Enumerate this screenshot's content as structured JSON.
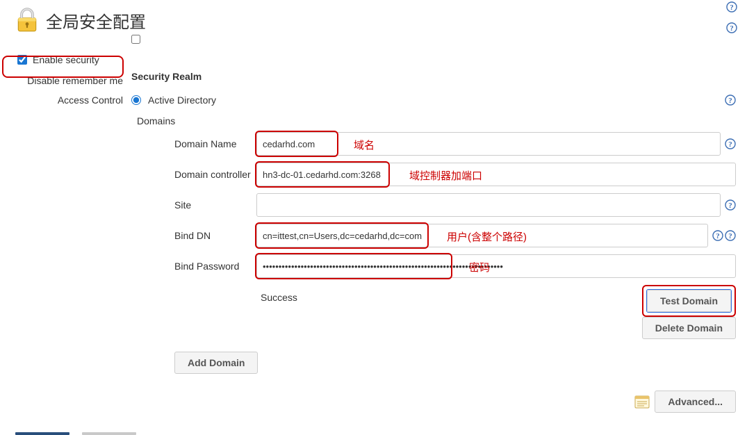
{
  "header": {
    "title": "全局安全配置"
  },
  "left": {
    "enable_label": "Enable security",
    "enable_checked": true,
    "disable_label": "Disable remember me",
    "disable_checked": false,
    "access_label": "Access Control"
  },
  "realm": {
    "section_title": "Security Realm",
    "active_directory_label": "Active Directory",
    "active_directory_selected": true,
    "domains_label": "Domains",
    "fields": {
      "domain_name": {
        "label": "Domain Name",
        "value": "cedarhd.com"
      },
      "domain_controller": {
        "label": "Domain controller",
        "value": "hn3-dc-01.cedarhd.com:3268"
      },
      "site": {
        "label": "Site",
        "value": ""
      },
      "bind_dn": {
        "label": "Bind DN",
        "value": "cn=ittest,cn=Users,dc=cedarhd,dc=com"
      },
      "bind_password": {
        "label": "Bind Password",
        "value": "••••••••••••••••••••••••••••••••••••••••••••••••••••••••••••••••••••••••••••"
      }
    },
    "success_text": "Success",
    "buttons": {
      "test": "Test Domain",
      "delete": "Delete Domain",
      "add": "Add Domain",
      "advanced": "Advanced..."
    }
  },
  "annotations": {
    "domain_name": "域名",
    "domain_controller": "域控制器加端口",
    "bind_dn": "用户(含整个路径)",
    "bind_password": "密码"
  }
}
